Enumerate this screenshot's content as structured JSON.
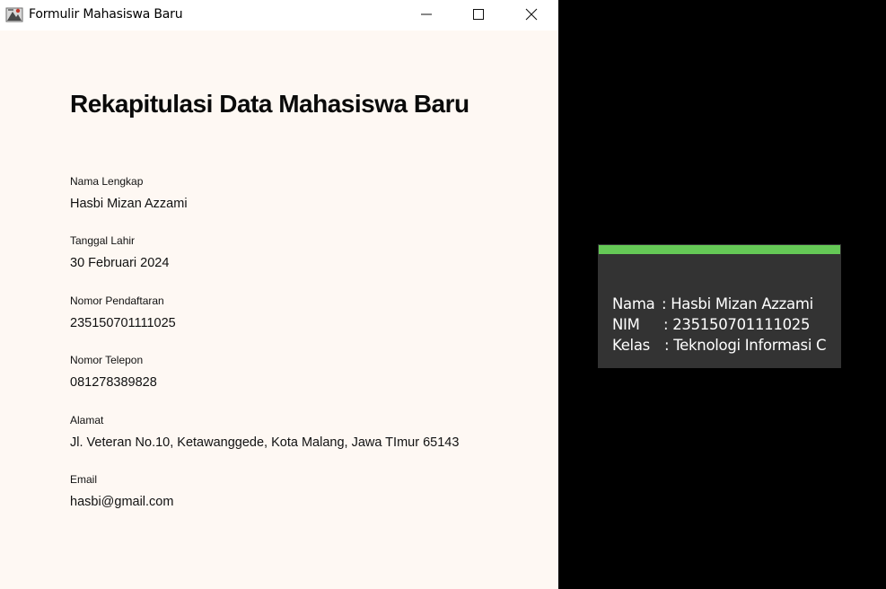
{
  "window": {
    "title": "Formulir Mahasiswa Baru",
    "icon": "java-app-icon",
    "controls": [
      "minimize-icon",
      "maximize-icon",
      "close-icon"
    ]
  },
  "main": {
    "heading": "Rekapitulasi Data Mahasiswa Baru",
    "fields": [
      {
        "label": "Nama Lengkap",
        "value": "Hasbi Mizan Azzami"
      },
      {
        "label": "Tanggal Lahir",
        "value": "30 Februari 2024"
      },
      {
        "label": "Nomor Pendaftaran",
        "value": "235150701111025"
      },
      {
        "label": "Nomor Telepon",
        "value": "081278389828"
      },
      {
        "label": "Alamat",
        "value": "Jl. Veteran No.10, Ketawanggede, Kota Malang, Jawa TImur 65143"
      },
      {
        "label": "Email",
        "value": "hasbi@gmail.com"
      }
    ]
  },
  "toast": {
    "accent_color": "#65c956",
    "rows": [
      {
        "key": "Nama",
        "value": ": Hasbi Mizan Azzami"
      },
      {
        "key": "NIM",
        "value": ": 235150701111025"
      },
      {
        "key": "Kelas",
        "value": ": Teknologi Informasi C"
      }
    ]
  },
  "colors": {
    "window_background": "#fef8f3",
    "desktop_background": "#000000",
    "toast_background": "#333333"
  }
}
